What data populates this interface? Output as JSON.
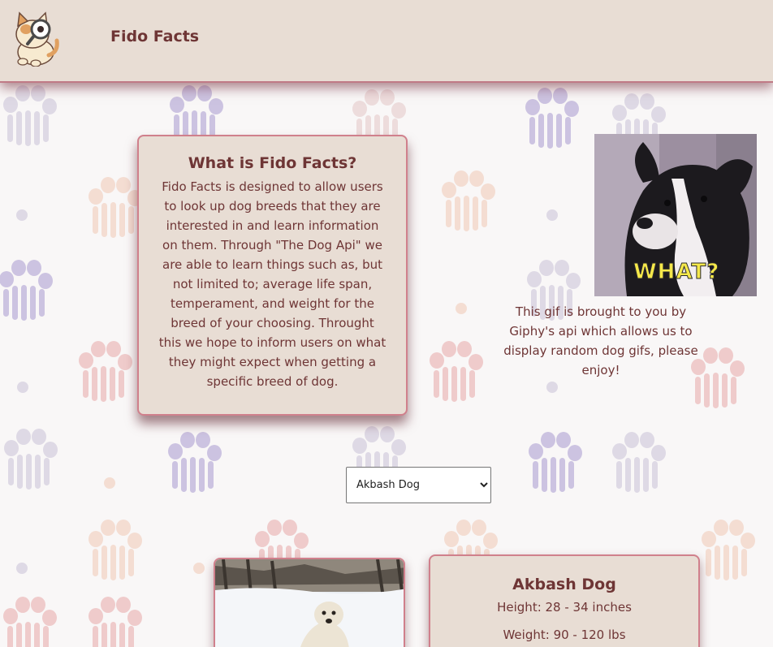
{
  "header": {
    "title": "Fido Facts",
    "logo_icon": "magnifier-cat-icon"
  },
  "about": {
    "title": "What is Fido Facts?",
    "text": "Fido Facts is designed to allow users to look up dog breeds that they are interested in and learn information on them. Through \"The Dog Api\" we are able to learn things such as, but not limited to; average life span, temperament, and weight for the breed of your choosing. Throught this we hope to inform users on what they might expect when getting a specific breed of dog."
  },
  "gif": {
    "overlay_text": "WHAT?",
    "caption": "This gif is brought to you by Giphy's api which allows us to display random dog gifs, please enjoy!"
  },
  "breed_select": {
    "selected": "Akbash Dog"
  },
  "breed": {
    "name": "Akbash Dog",
    "height": "Height: 28 - 34 inches",
    "weight": "Weight: 90 - 120 lbs"
  },
  "colors": {
    "accent_text": "#6e3535",
    "card_bg": "#e8ddd4",
    "card_border": "#d0808c",
    "page_bg": "#f9f7f7"
  }
}
